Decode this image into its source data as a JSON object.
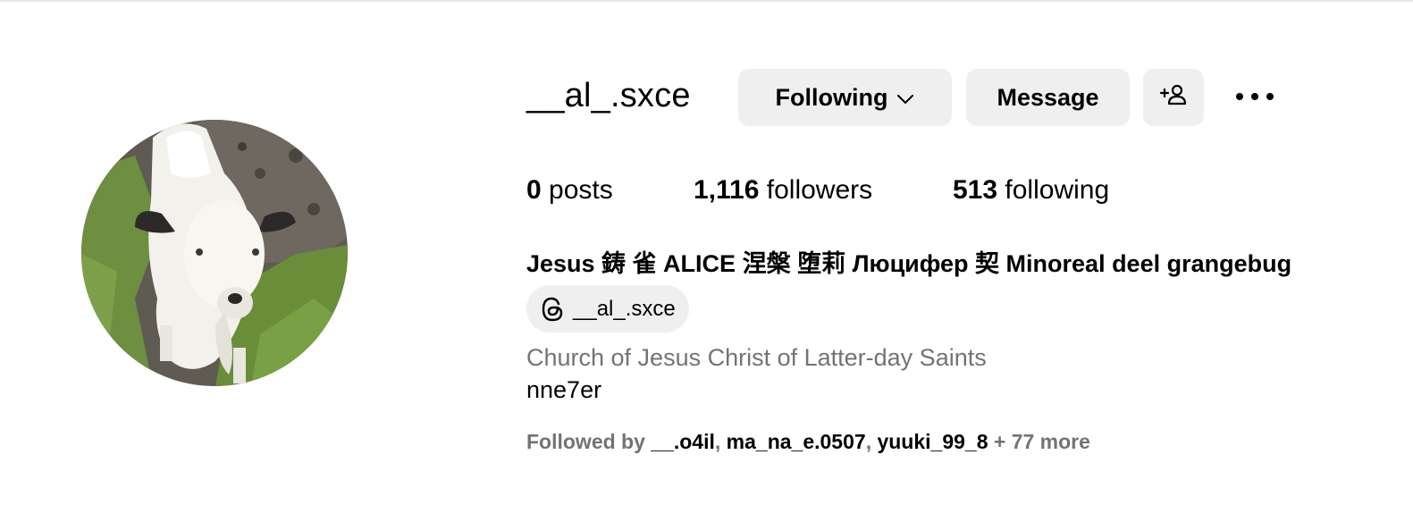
{
  "profile": {
    "username": "__al_.sxce",
    "buttons": {
      "following_label": "Following",
      "message_label": "Message"
    },
    "stats": {
      "posts_count": "0",
      "posts_label": "posts",
      "followers_count": "1,116",
      "followers_label": "followers",
      "following_count": "513",
      "following_label": "following"
    },
    "full_name": "Jesus 鋳 雀 ALICE 涅槃 堕莉 Люцифер 契 Minoreal deel grangebug",
    "threads_handle": "__al_.sxce",
    "category": "Church of Jesus Christ of Latter-day Saints",
    "bio": "nne7er",
    "followed_by": {
      "prefix": "Followed by",
      "users": [
        "__.o4il",
        "ma_na_e.0507",
        "yuuki_99_8"
      ],
      "separator": ",",
      "more": "+ 77 more"
    }
  },
  "icons": {
    "following_dropdown": "chevron-down-icon",
    "add_user": "add-user-icon",
    "more": "more-options-icon",
    "threads": "threads-icon"
  },
  "colors": {
    "button_bg": "#efefef",
    "secondary_text": "#737373",
    "primary_text": "#000000"
  }
}
